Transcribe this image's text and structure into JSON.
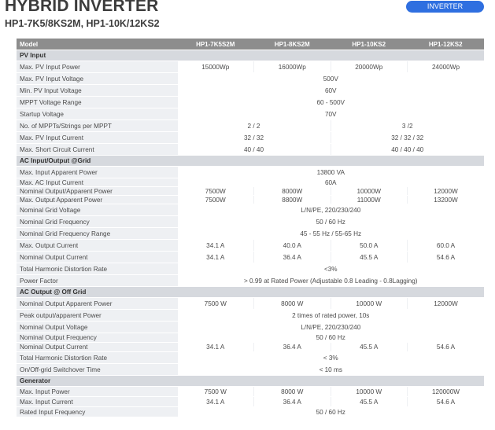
{
  "header": {
    "title": "HYBRID INVERTER",
    "subtitle": "HP1-7K5/8KS2M, HP1-10K/12KS2",
    "badge": "INVERTER"
  },
  "table": {
    "columns": [
      "Model",
      "HP1-7K5S2M",
      "HP1-8KS2M",
      "HP1-10KS2",
      "HP1-12KS2"
    ],
    "rows": [
      {
        "section": "PV Input"
      },
      {
        "label": "Max. PV Input Power",
        "cells": [
          {
            "v": "15000Wp",
            "span": 1
          },
          {
            "v": "16000Wp",
            "span": 1
          },
          {
            "v": "20000Wp",
            "span": 1
          },
          {
            "v": "24000Wp",
            "span": 1
          }
        ],
        "h": 15
      },
      {
        "label": "Max. PV Input Voltage",
        "cells": [
          {
            "v": "500V",
            "span": 4
          }
        ],
        "h": 15
      },
      {
        "label": "Min. PV Input Voltage",
        "cells": [
          {
            "v": "60V",
            "span": 4
          }
        ],
        "h": 15
      },
      {
        "label": "MPPT Voltage Range",
        "cells": [
          {
            "v": "60 - 500V",
            "span": 4
          }
        ],
        "h": 15
      },
      {
        "label": "Startup Voltage",
        "cells": [
          {
            "v": "70V",
            "span": 4
          }
        ],
        "h": 15
      },
      {
        "label": "No. of MPPTs/Strings per MPPT",
        "cells": [
          {
            "v": "2 / 2",
            "span": 2
          },
          {
            "v": "3 /2",
            "span": 2
          }
        ],
        "h": 15
      },
      {
        "label": "Max. PV Input Current",
        "cells": [
          {
            "v": "32 / 32",
            "span": 2
          },
          {
            "v": "32 / 32 / 32",
            "span": 2
          }
        ],
        "h": 15
      },
      {
        "label": "Max. Short Circuit Current",
        "cells": [
          {
            "v": "40 / 40",
            "span": 2
          },
          {
            "v": "40 / 40 / 40",
            "span": 2
          }
        ],
        "h": 15
      },
      {
        "section": "AC Input/Output @Grid"
      },
      {
        "label": "Max. Input Apparent Power",
        "cells": [
          {
            "v": "13800 VA",
            "span": 4
          }
        ],
        "h": 15
      },
      {
        "label": "Max. AC Input Current",
        "cells": [
          {
            "v": "60A",
            "span": 4
          }
        ],
        "h": 11
      },
      {
        "label": "Nominal Output/Apparent Power",
        "cells": [
          {
            "v": "7500W",
            "span": 1
          },
          {
            "v": "8000W",
            "span": 1
          },
          {
            "v": "10000W",
            "span": 1
          },
          {
            "v": "12000W",
            "span": 1
          }
        ],
        "h": 11
      },
      {
        "label": "Max. Output Apparent Power",
        "cells": [
          {
            "v": "7500W",
            "span": 1
          },
          {
            "v": "8800W",
            "span": 1
          },
          {
            "v": "11000W",
            "span": 1
          },
          {
            "v": "13200W",
            "span": 1
          }
        ],
        "h": 11
      },
      {
        "label": "Nominal Grid Voltage",
        "cells": [
          {
            "v": "L/N/PE, 220/230/240",
            "span": 4
          }
        ],
        "h": 15
      },
      {
        "label": "Nominal Grid Frequency",
        "cells": [
          {
            "v": "50 / 60 Hz",
            "span": 4
          }
        ],
        "h": 15
      },
      {
        "label": "Nominal Grid Frequency Range",
        "cells": [
          {
            "v": "45 - 55 Hz / 55-65 Hz",
            "span": 4
          }
        ],
        "h": 15
      },
      {
        "label": "Max. Output Current",
        "cells": [
          {
            "v": "34.1 A",
            "span": 1
          },
          {
            "v": "40.0 A",
            "span": 1
          },
          {
            "v": "50.0 A",
            "span": 1
          },
          {
            "v": "60.0 A",
            "span": 1
          }
        ],
        "h": 15
      },
      {
        "label": "Nominal Output Current",
        "cells": [
          {
            "v": "34.1 A",
            "span": 1
          },
          {
            "v": "36.4 A",
            "span": 1
          },
          {
            "v": "45.5 A",
            "span": 1
          },
          {
            "v": "54.6 A",
            "span": 1
          }
        ],
        "h": 15
      },
      {
        "label": "Total Harmonic Distortion Rate",
        "cells": [
          {
            "v": "<3%",
            "span": 4
          }
        ],
        "h": 15
      },
      {
        "label": "Power Factor",
        "cells": [
          {
            "v": "> 0.99 at Rated Power (Adjustable 0.8 Leading - 0.8Lagging)",
            "span": 4
          }
        ],
        "h": 15
      },
      {
        "section": "AC Output @ Off Grid"
      },
      {
        "label": "Nominal Output Apparent Power",
        "cells": [
          {
            "v": "7500 W",
            "span": 1
          },
          {
            "v": "8000 W",
            "span": 1
          },
          {
            "v": "10000 W",
            "span": 1
          },
          {
            "v": "12000W",
            "span": 1
          }
        ],
        "h": 15
      },
      {
        "label": "Peak output/apparent Power",
        "cells": [
          {
            "v": "2 times of rated power, 10s",
            "span": 4
          }
        ],
        "h": 15
      },
      {
        "label": "Nominal Output Voltage",
        "cells": [
          {
            "v": "L/N/PE, 220/230/240",
            "span": 4
          }
        ],
        "h": 15
      },
      {
        "label": "Nominal Output Frequency",
        "cells": [
          {
            "v": "50 / 60 Hz",
            "span": 4
          }
        ],
        "h": 12
      },
      {
        "label": "Nominal Output Current",
        "cells": [
          {
            "v": "34.1 A",
            "span": 1
          },
          {
            "v": "36.4 A",
            "span": 1
          },
          {
            "v": "45.5 A",
            "span": 1
          },
          {
            "v": "54.6 A",
            "span": 1
          }
        ],
        "h": 12
      },
      {
        "label": "Total Harmonic Distortion Rate",
        "cells": [
          {
            "v": "< 3%",
            "span": 4
          }
        ],
        "h": 15
      },
      {
        "label": "On/Off-grid Switchover Time",
        "cells": [
          {
            "v": "< 10 ms",
            "span": 4
          }
        ],
        "h": 15
      },
      {
        "section": "Generator"
      },
      {
        "label": "Max. Input Power",
        "cells": [
          {
            "v": "7500 W",
            "span": 1
          },
          {
            "v": "8000 W",
            "span": 1
          },
          {
            "v": "10000 W",
            "span": 1
          },
          {
            "v": "120000W",
            "span": 1
          }
        ],
        "h": 13
      },
      {
        "label": "Max. Input Current",
        "cells": [
          {
            "v": "34.1 A",
            "span": 1
          },
          {
            "v": "36.4 A",
            "span": 1
          },
          {
            "v": "45.5 A",
            "span": 1
          },
          {
            "v": "54.6 A",
            "span": 1
          }
        ],
        "h": 13
      },
      {
        "label": "Rated Input Frequency",
        "cells": [
          {
            "v": "50 / 60 Hz",
            "span": 4
          }
        ],
        "h": 13
      }
    ]
  }
}
